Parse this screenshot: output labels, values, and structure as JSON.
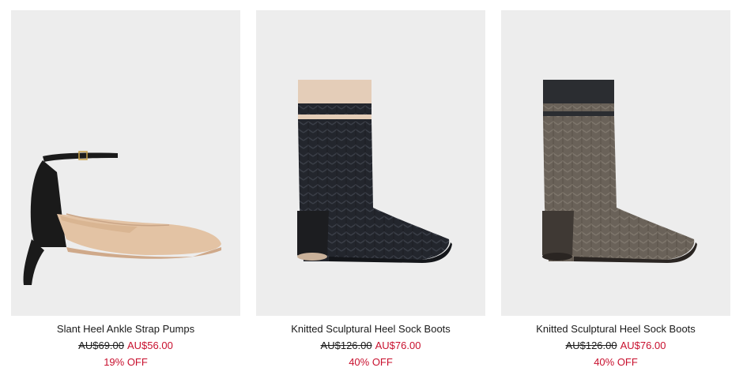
{
  "products": [
    {
      "name": "Slant Heel Ankle Strap Pumps",
      "original_price": "AU$69.00",
      "sale_price": "AU$56.00",
      "discount": "19% OFF"
    },
    {
      "name": "Knitted Sculptural Heel Sock Boots",
      "original_price": "AU$126.00",
      "sale_price": "AU$76.00",
      "discount": "40% OFF"
    },
    {
      "name": "Knitted Sculptural Heel Sock Boots",
      "original_price": "AU$126.00",
      "sale_price": "AU$76.00",
      "discount": "40% OFF"
    }
  ],
  "colors": {
    "sale": "#c8102e",
    "image_bg": "#ededed",
    "text": "#1a1a1a"
  }
}
